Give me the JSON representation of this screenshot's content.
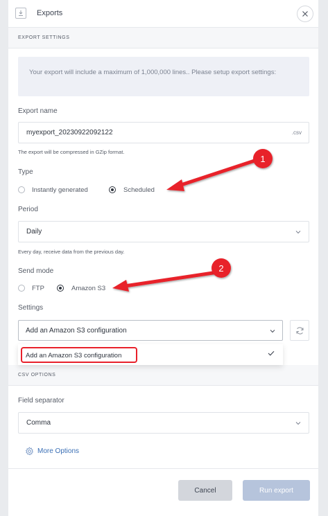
{
  "header": {
    "title": "Exports",
    "export_icon": "download-box-icon",
    "close_icon": "close-icon"
  },
  "export_settings": {
    "section_title": "EXPORT SETTINGS",
    "info_text": "Your export will include a maximum of 1,000,000 lines.. Please setup export settings:",
    "export_name": {
      "label": "Export name",
      "value": "myexport_20230922092122",
      "suffix": ".csv",
      "hint": "The export will be compressed in GZip format."
    },
    "type": {
      "label": "Type",
      "options": [
        "Instantly generated",
        "Scheduled"
      ],
      "selected": "Scheduled"
    },
    "period": {
      "label": "Period",
      "value": "Daily",
      "hint": "Every day, receive data from the previous day."
    },
    "send_mode": {
      "label": "Send mode",
      "options": [
        "FTP",
        "Amazon S3"
      ],
      "selected": "Amazon S3"
    },
    "settings": {
      "label": "Settings",
      "value": "Add an Amazon S3 configuration",
      "dropdown_options": [
        "Add an Amazon S3 configuration"
      ],
      "refresh_icon": "refresh-icon"
    }
  },
  "csv_options": {
    "section_title": "CSV OPTIONS",
    "field_separator": {
      "label": "Field separator",
      "value": "Comma"
    },
    "more_options": "More Options"
  },
  "footer": {
    "cancel": "Cancel",
    "run_export": "Run export"
  },
  "annotations": [
    {
      "number": "1"
    },
    {
      "number": "2"
    }
  ],
  "colors": {
    "annotation_red": "#e8202a",
    "link_blue": "#3a6fb5",
    "run_button": "#b6c4dc",
    "cancel_button": "#d3d6dc",
    "info_bg": "#eef0f6"
  }
}
